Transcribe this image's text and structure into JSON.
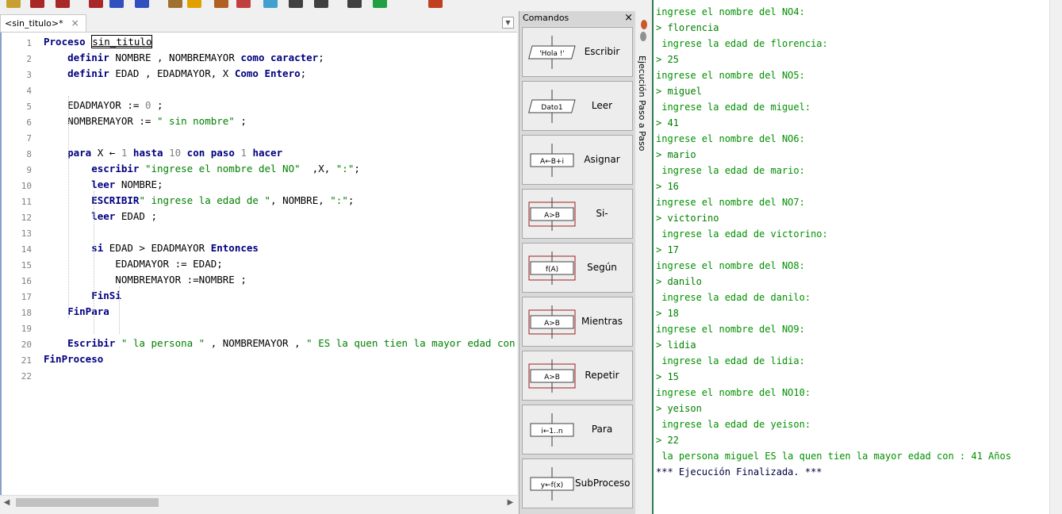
{
  "toolbar": {
    "icons": [
      "new-file-icon",
      "open-icon",
      "save-icon",
      "save-as-icon",
      "run-icon",
      "step-icon",
      "flowchart-icon",
      "print-icon",
      "cut-icon",
      "copy-icon",
      "paste-icon",
      "undo-icon",
      "redo-icon",
      "diagram-icon",
      "debug-icon",
      "help-icon"
    ]
  },
  "tab": {
    "label": "<sin_titulo>*",
    "close": "×",
    "dropdown": "▼"
  },
  "editor": {
    "line_numbers": [
      "1",
      "2",
      "3",
      "4",
      "5",
      "6",
      "7",
      "8",
      "9",
      "10",
      "11",
      "12",
      "13",
      "14",
      "15",
      "16",
      "17",
      "18",
      "19",
      "20",
      "21",
      "22"
    ],
    "lines": [
      [
        [
          "kw",
          "Proceso "
        ],
        [
          "pu",
          "sin_titulo"
        ]
      ],
      [
        [
          "pu",
          "    "
        ],
        [
          "kw",
          "definir "
        ],
        [
          "pu",
          "NOMBRE , NOMBREMAYOR "
        ],
        [
          "kw",
          "como caracter"
        ],
        [
          "pu",
          ";"
        ]
      ],
      [
        [
          "pu",
          "    "
        ],
        [
          "kw",
          "definir "
        ],
        [
          "pu",
          "EDAD , EDADMAYOR, X "
        ],
        [
          "kw",
          "Como Entero"
        ],
        [
          "pu",
          ";"
        ]
      ],
      [],
      [
        [
          "pu",
          "    EDADMAYOR := "
        ],
        [
          "nm",
          "0"
        ],
        [
          "pu",
          " ;"
        ]
      ],
      [
        [
          "pu",
          "    NOMBREMAYOR := "
        ],
        [
          "st",
          "\" sin nombre\""
        ],
        [
          "pu",
          " ;"
        ]
      ],
      [],
      [
        [
          "pu",
          "    "
        ],
        [
          "kw",
          "para "
        ],
        [
          "pu",
          "X ← "
        ],
        [
          "nm",
          "1"
        ],
        [
          "kw",
          " hasta "
        ],
        [
          "nm",
          "10"
        ],
        [
          "kw",
          " con paso "
        ],
        [
          "nm",
          "1"
        ],
        [
          "kw",
          " hacer"
        ]
      ],
      [
        [
          "pu",
          "        "
        ],
        [
          "kw",
          "escribir "
        ],
        [
          "st",
          "\"ingrese el nombre del NO\""
        ],
        [
          "pu",
          "  ,X, "
        ],
        [
          "st",
          "\":\""
        ],
        [
          "pu",
          ";"
        ]
      ],
      [
        [
          "pu",
          "        "
        ],
        [
          "kw",
          "leer "
        ],
        [
          "pu",
          "NOMBRE;"
        ]
      ],
      [
        [
          "pu",
          "        "
        ],
        [
          "kw",
          "ESCRIBIR"
        ],
        [
          "st",
          "\" ingrese la edad de \""
        ],
        [
          "pu",
          ", NOMBRE, "
        ],
        [
          "st",
          "\":\""
        ],
        [
          "pu",
          ";"
        ]
      ],
      [
        [
          "pu",
          "        "
        ],
        [
          "kw",
          "leer "
        ],
        [
          "pu",
          "EDAD ;"
        ]
      ],
      [],
      [
        [
          "pu",
          "        "
        ],
        [
          "kw",
          "si "
        ],
        [
          "pu",
          "EDAD > EDADMAYOR "
        ],
        [
          "kw",
          "Entonces"
        ]
      ],
      [
        [
          "pu",
          "            EDADMAYOR := EDAD;"
        ]
      ],
      [
        [
          "pu",
          "            NOMBREMAYOR :=NOMBRE ;"
        ]
      ],
      [
        [
          "pu",
          "        "
        ],
        [
          "kw",
          "FinSi"
        ]
      ],
      [
        [
          "pu",
          "    "
        ],
        [
          "kw",
          "FinPara"
        ]
      ],
      [],
      [
        [
          "pu",
          "    "
        ],
        [
          "kw",
          "Escribir "
        ],
        [
          "st",
          "\" la persona \""
        ],
        [
          "pu",
          " , NOMBREMAYOR , "
        ],
        [
          "st",
          "\" ES la quen tien la mayor edad con : \""
        ]
      ],
      [
        [
          "kw",
          "FinProceso"
        ]
      ],
      []
    ]
  },
  "commands": {
    "title": "Comandos",
    "close": "×",
    "buttons": [
      {
        "label": "Escribir",
        "icon": "escribir-icon",
        "glyph": "'Hola !'"
      },
      {
        "label": "Leer",
        "icon": "leer-icon",
        "glyph": "Dato1"
      },
      {
        "label": "Asignar",
        "icon": "asignar-icon",
        "glyph": "A←B+i"
      },
      {
        "label": "Si-Entonces",
        "icon": "si-entonces-icon",
        "glyph": "A>B"
      },
      {
        "label": "Según",
        "icon": "segun-icon",
        "glyph": "f(A)"
      },
      {
        "label": "Mientras",
        "icon": "mientras-icon",
        "glyph": "A>B"
      },
      {
        "label": "Repetir",
        "icon": "repetir-icon",
        "glyph": "A>B"
      },
      {
        "label": "Para",
        "icon": "para-icon",
        "glyph": "i←1..n"
      },
      {
        "label": "SubProceso",
        "icon": "subproceso-icon",
        "glyph": "y←f(x)"
      }
    ]
  },
  "side": {
    "label": "Ejecución Paso a Paso"
  },
  "console": {
    "lines": [
      {
        "t": "out",
        "s": "ingrese el nombre del NO4:"
      },
      {
        "t": "in",
        "s": "> florencia"
      },
      {
        "t": "out",
        "s": " ingrese la edad de florencia:"
      },
      {
        "t": "in",
        "s": "> 25"
      },
      {
        "t": "out",
        "s": "ingrese el nombre del NO5:"
      },
      {
        "t": "in",
        "s": "> miguel"
      },
      {
        "t": "out",
        "s": " ingrese la edad de miguel:"
      },
      {
        "t": "in",
        "s": "> 41"
      },
      {
        "t": "out",
        "s": "ingrese el nombre del NO6:"
      },
      {
        "t": "in",
        "s": "> mario"
      },
      {
        "t": "out",
        "s": " ingrese la edad de mario:"
      },
      {
        "t": "in",
        "s": "> 16"
      },
      {
        "t": "out",
        "s": "ingrese el nombre del NO7:"
      },
      {
        "t": "in",
        "s": "> victorino"
      },
      {
        "t": "out",
        "s": " ingrese la edad de victorino:"
      },
      {
        "t": "in",
        "s": "> 17"
      },
      {
        "t": "out",
        "s": "ingrese el nombre del NO8:"
      },
      {
        "t": "in",
        "s": "> danilo"
      },
      {
        "t": "out",
        "s": " ingrese la edad de danilo:"
      },
      {
        "t": "in",
        "s": "> 18"
      },
      {
        "t": "out",
        "s": "ingrese el nombre del NO9:"
      },
      {
        "t": "in",
        "s": "> lidia"
      },
      {
        "t": "out",
        "s": " ingrese la edad de lidia:"
      },
      {
        "t": "in",
        "s": "> 15"
      },
      {
        "t": "out",
        "s": "ingrese el nombre del NO10:"
      },
      {
        "t": "in",
        "s": "> yeison"
      },
      {
        "t": "out",
        "s": " ingrese la edad de yeison:"
      },
      {
        "t": "in",
        "s": "> 22"
      },
      {
        "t": "out",
        "s": " la persona miguel ES la quen tien la mayor edad con : 41 Años"
      },
      {
        "t": "fin",
        "s": "*** Ejecución Finalizada. ***"
      }
    ]
  },
  "colors": {
    "divider": "#2e7d4e",
    "console_text": "#009000",
    "keyword": "#000080",
    "string": "#008000"
  }
}
